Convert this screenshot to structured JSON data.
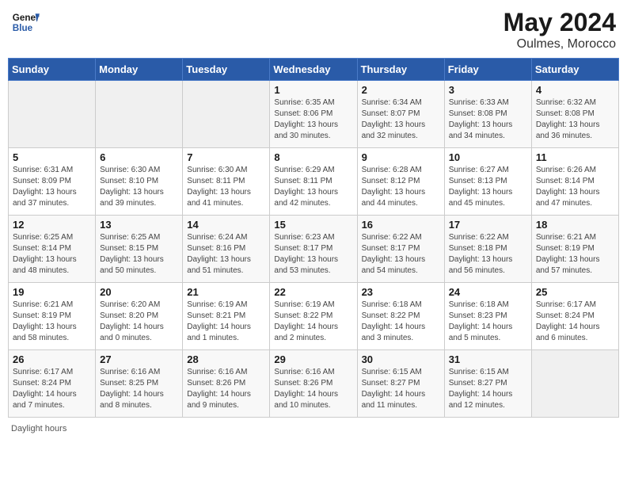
{
  "header": {
    "logo_line1": "General",
    "logo_line2": "Blue",
    "month_year": "May 2024",
    "location": "Oulmes, Morocco"
  },
  "days_of_week": [
    "Sunday",
    "Monday",
    "Tuesday",
    "Wednesday",
    "Thursday",
    "Friday",
    "Saturday"
  ],
  "weeks": [
    [
      {
        "day": "",
        "info": ""
      },
      {
        "day": "",
        "info": ""
      },
      {
        "day": "",
        "info": ""
      },
      {
        "day": "1",
        "info": "Sunrise: 6:35 AM\nSunset: 8:06 PM\nDaylight: 13 hours\nand 30 minutes."
      },
      {
        "day": "2",
        "info": "Sunrise: 6:34 AM\nSunset: 8:07 PM\nDaylight: 13 hours\nand 32 minutes."
      },
      {
        "day": "3",
        "info": "Sunrise: 6:33 AM\nSunset: 8:08 PM\nDaylight: 13 hours\nand 34 minutes."
      },
      {
        "day": "4",
        "info": "Sunrise: 6:32 AM\nSunset: 8:08 PM\nDaylight: 13 hours\nand 36 minutes."
      }
    ],
    [
      {
        "day": "5",
        "info": "Sunrise: 6:31 AM\nSunset: 8:09 PM\nDaylight: 13 hours\nand 37 minutes."
      },
      {
        "day": "6",
        "info": "Sunrise: 6:30 AM\nSunset: 8:10 PM\nDaylight: 13 hours\nand 39 minutes."
      },
      {
        "day": "7",
        "info": "Sunrise: 6:30 AM\nSunset: 8:11 PM\nDaylight: 13 hours\nand 41 minutes."
      },
      {
        "day": "8",
        "info": "Sunrise: 6:29 AM\nSunset: 8:11 PM\nDaylight: 13 hours\nand 42 minutes."
      },
      {
        "day": "9",
        "info": "Sunrise: 6:28 AM\nSunset: 8:12 PM\nDaylight: 13 hours\nand 44 minutes."
      },
      {
        "day": "10",
        "info": "Sunrise: 6:27 AM\nSunset: 8:13 PM\nDaylight: 13 hours\nand 45 minutes."
      },
      {
        "day": "11",
        "info": "Sunrise: 6:26 AM\nSunset: 8:14 PM\nDaylight: 13 hours\nand 47 minutes."
      }
    ],
    [
      {
        "day": "12",
        "info": "Sunrise: 6:25 AM\nSunset: 8:14 PM\nDaylight: 13 hours\nand 48 minutes."
      },
      {
        "day": "13",
        "info": "Sunrise: 6:25 AM\nSunset: 8:15 PM\nDaylight: 13 hours\nand 50 minutes."
      },
      {
        "day": "14",
        "info": "Sunrise: 6:24 AM\nSunset: 8:16 PM\nDaylight: 13 hours\nand 51 minutes."
      },
      {
        "day": "15",
        "info": "Sunrise: 6:23 AM\nSunset: 8:17 PM\nDaylight: 13 hours\nand 53 minutes."
      },
      {
        "day": "16",
        "info": "Sunrise: 6:22 AM\nSunset: 8:17 PM\nDaylight: 13 hours\nand 54 minutes."
      },
      {
        "day": "17",
        "info": "Sunrise: 6:22 AM\nSunset: 8:18 PM\nDaylight: 13 hours\nand 56 minutes."
      },
      {
        "day": "18",
        "info": "Sunrise: 6:21 AM\nSunset: 8:19 PM\nDaylight: 13 hours\nand 57 minutes."
      }
    ],
    [
      {
        "day": "19",
        "info": "Sunrise: 6:21 AM\nSunset: 8:19 PM\nDaylight: 13 hours\nand 58 minutes."
      },
      {
        "day": "20",
        "info": "Sunrise: 6:20 AM\nSunset: 8:20 PM\nDaylight: 14 hours\nand 0 minutes."
      },
      {
        "day": "21",
        "info": "Sunrise: 6:19 AM\nSunset: 8:21 PM\nDaylight: 14 hours\nand 1 minutes."
      },
      {
        "day": "22",
        "info": "Sunrise: 6:19 AM\nSunset: 8:22 PM\nDaylight: 14 hours\nand 2 minutes."
      },
      {
        "day": "23",
        "info": "Sunrise: 6:18 AM\nSunset: 8:22 PM\nDaylight: 14 hours\nand 3 minutes."
      },
      {
        "day": "24",
        "info": "Sunrise: 6:18 AM\nSunset: 8:23 PM\nDaylight: 14 hours\nand 5 minutes."
      },
      {
        "day": "25",
        "info": "Sunrise: 6:17 AM\nSunset: 8:24 PM\nDaylight: 14 hours\nand 6 minutes."
      }
    ],
    [
      {
        "day": "26",
        "info": "Sunrise: 6:17 AM\nSunset: 8:24 PM\nDaylight: 14 hours\nand 7 minutes."
      },
      {
        "day": "27",
        "info": "Sunrise: 6:16 AM\nSunset: 8:25 PM\nDaylight: 14 hours\nand 8 minutes."
      },
      {
        "day": "28",
        "info": "Sunrise: 6:16 AM\nSunset: 8:26 PM\nDaylight: 14 hours\nand 9 minutes."
      },
      {
        "day": "29",
        "info": "Sunrise: 6:16 AM\nSunset: 8:26 PM\nDaylight: 14 hours\nand 10 minutes."
      },
      {
        "day": "30",
        "info": "Sunrise: 6:15 AM\nSunset: 8:27 PM\nDaylight: 14 hours\nand 11 minutes."
      },
      {
        "day": "31",
        "info": "Sunrise: 6:15 AM\nSunset: 8:27 PM\nDaylight: 14 hours\nand 12 minutes."
      },
      {
        "day": "",
        "info": ""
      }
    ]
  ],
  "footer_label": "Daylight hours"
}
